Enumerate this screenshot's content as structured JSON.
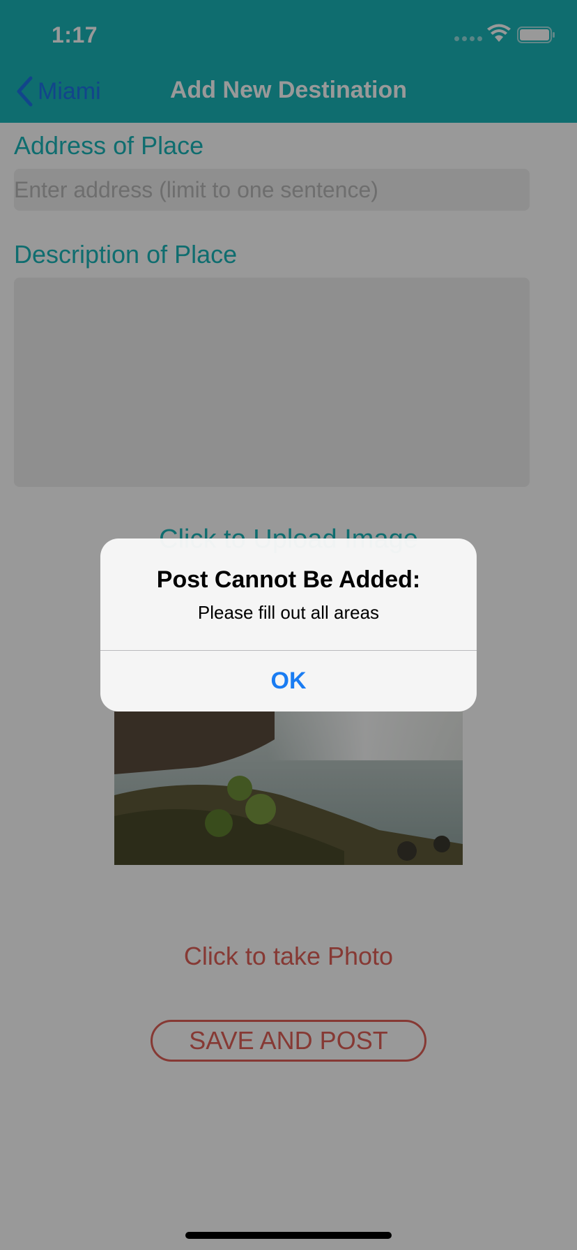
{
  "status_bar": {
    "time": "1:17"
  },
  "nav": {
    "back_label": "Miami",
    "title": "Add New Destination"
  },
  "form": {
    "address_label": "Address of Place",
    "address_placeholder": "Enter address (limit to one sentence)",
    "description_label": "Description of Place",
    "upload_label": "Click to Upload Image",
    "take_photo_label": "Click to take Photo",
    "save_label": "SAVE AND POST"
  },
  "alert": {
    "title": "Post Cannot Be Added:",
    "message": "Please fill out all areas",
    "ok_label": "OK"
  },
  "colors": {
    "teal": "#1ab6b9",
    "coral": "#e05f57",
    "ios_blue": "#1a7cf2"
  }
}
